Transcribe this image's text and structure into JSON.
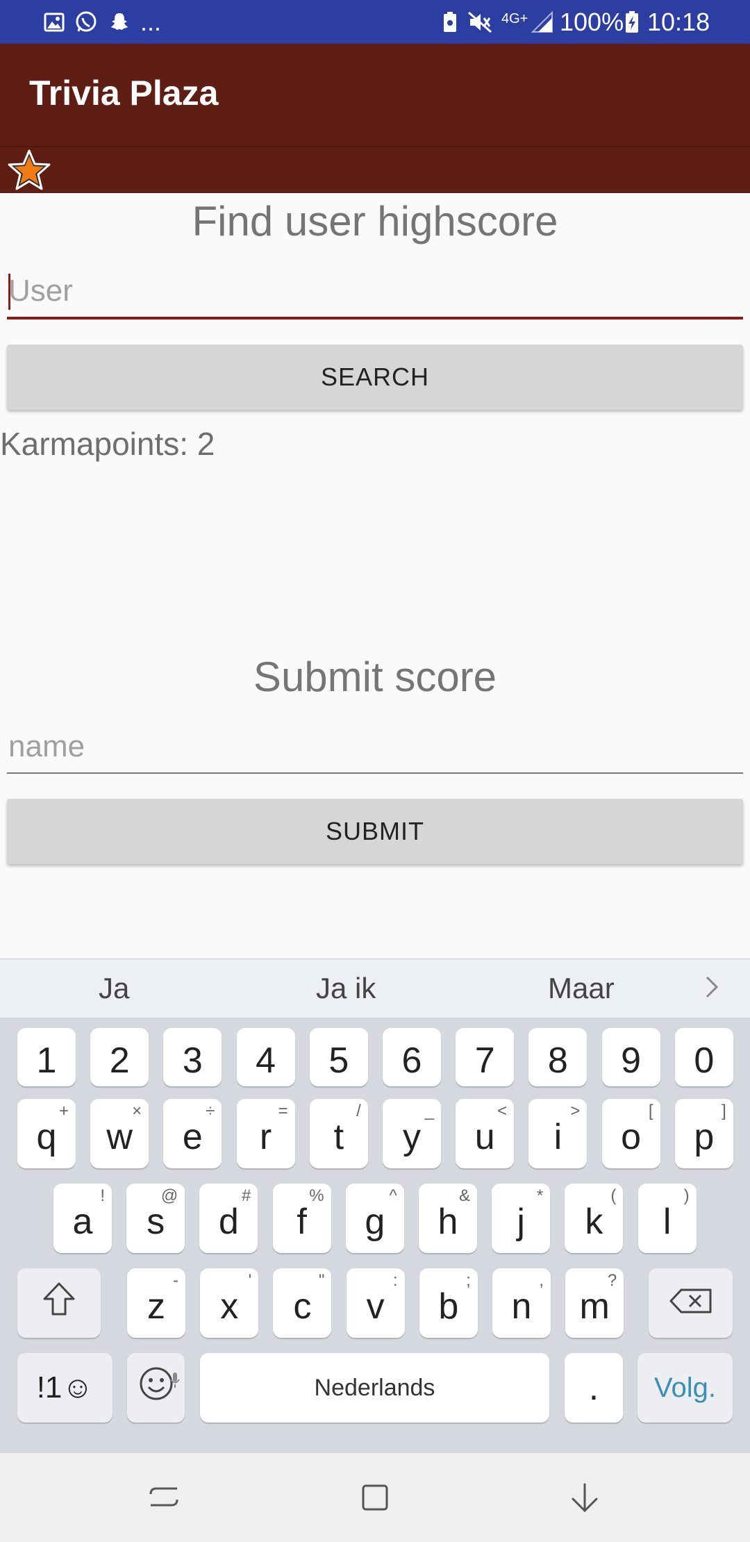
{
  "status_bar": {
    "overflow": "...",
    "network": "4G+",
    "battery": "100%",
    "time": "10:18",
    "color": "#2d3ea2"
  },
  "app_bar": {
    "title": "Trivia Plaza",
    "color": "#5f1e14"
  },
  "find_section": {
    "heading": "Find user highscore",
    "input_placeholder": "User",
    "input_value": "",
    "button_label": "SEARCH",
    "result": "Karmapoints: 2"
  },
  "submit_section": {
    "heading": "Submit score",
    "input_placeholder": "name",
    "input_value": "",
    "button_label": "SUBMIT"
  },
  "keyboard": {
    "suggestions": [
      "Ja",
      "Ja ik",
      "Maar"
    ],
    "number_row": [
      "1",
      "2",
      "3",
      "4",
      "5",
      "6",
      "7",
      "8",
      "9",
      "0"
    ],
    "row1": [
      {
        "k": "q",
        "s": "+"
      },
      {
        "k": "w",
        "s": "×"
      },
      {
        "k": "e",
        "s": "÷"
      },
      {
        "k": "r",
        "s": "="
      },
      {
        "k": "t",
        "s": "/"
      },
      {
        "k": "y",
        "s": "_"
      },
      {
        "k": "u",
        "s": "<"
      },
      {
        "k": "i",
        "s": ">"
      },
      {
        "k": "o",
        "s": "["
      },
      {
        "k": "p",
        "s": "]"
      }
    ],
    "row2": [
      {
        "k": "a",
        "s": "!"
      },
      {
        "k": "s",
        "s": "@"
      },
      {
        "k": "d",
        "s": "#"
      },
      {
        "k": "f",
        "s": "%"
      },
      {
        "k": "g",
        "s": "^"
      },
      {
        "k": "h",
        "s": "&"
      },
      {
        "k": "j",
        "s": "*"
      },
      {
        "k": "k",
        "s": "("
      },
      {
        "k": "l",
        "s": ")"
      }
    ],
    "row3": [
      {
        "k": "z",
        "s": "-"
      },
      {
        "k": "x",
        "s": "'"
      },
      {
        "k": "c",
        "s": "\""
      },
      {
        "k": "v",
        "s": ":"
      },
      {
        "k": "b",
        "s": ";"
      },
      {
        "k": "n",
        "s": ","
      },
      {
        "k": "m",
        "s": "?"
      }
    ],
    "symbols_label": "!1☺",
    "space_label": "Nederlands",
    "period_label": ".",
    "enter_label": "Volg.",
    "enter_color": "#3a8fb7"
  }
}
